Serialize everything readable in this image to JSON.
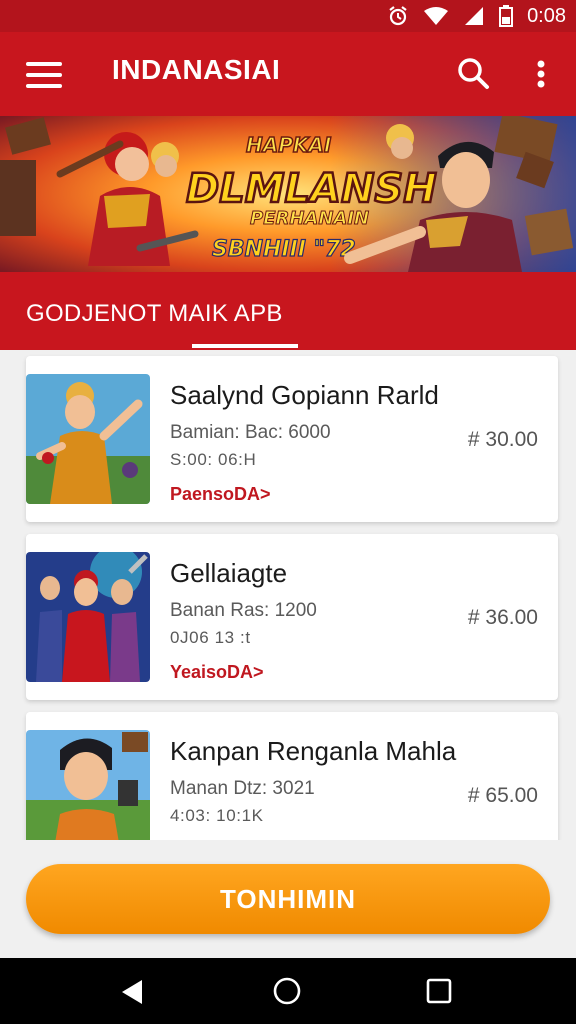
{
  "status_bar": {
    "time": "0:08",
    "icons": [
      "alarm-icon",
      "wifi-icon",
      "signal-icon",
      "battery-icon"
    ]
  },
  "app_bar": {
    "title": "INDANASIAI",
    "icons": [
      "menu-icon",
      "search-icon",
      "more-vert-icon"
    ]
  },
  "banner": {
    "headline_small": "HAPKAI",
    "headline_main": "DLMLANSH",
    "headline_sub": "PERHANAIN",
    "headline_bottom": "SBNHIII \"72"
  },
  "section": {
    "title": "GODJENOT MAIK APB"
  },
  "games": [
    {
      "title": "Saalynd Gopiann Rarld",
      "line1": "Bamian: Bac: 6000",
      "line2": "S:00: 06:H",
      "link": "PaensoDA>",
      "price": "# 30.00"
    },
    {
      "title": "Gellaiagte",
      "line1": "Banan Ras: 1200",
      "line2": "0J06  13 :t",
      "link": "YeaisoDA>",
      "price": "# 36.00"
    },
    {
      "title": "Kanpan Renganla Mahla",
      "line1": "Manan Dtz: 3021",
      "line2": "4:03: 10:1K",
      "link": "",
      "price": "# 65.00"
    }
  ],
  "cta": {
    "label": "TONHIMIN"
  },
  "colors": {
    "primary_red": "#c8161e",
    "cta_orange": "#f59a10",
    "link_red": "#c01820"
  },
  "nav_bar": {
    "icons": [
      "back-icon",
      "home-icon",
      "recents-icon"
    ]
  }
}
